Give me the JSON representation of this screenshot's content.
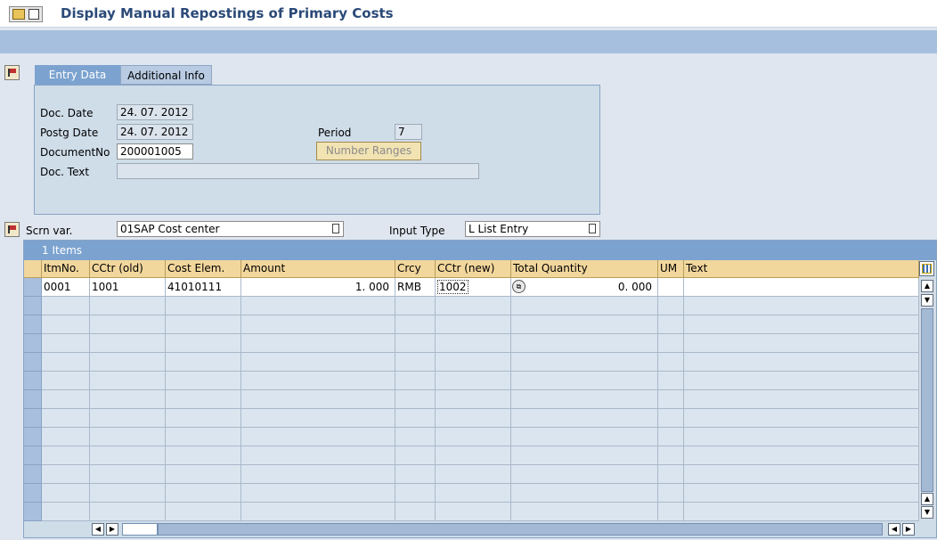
{
  "title": "Display Manual Repostings of Primary Costs",
  "tabs": [
    {
      "label": "Entry Data"
    },
    {
      "label": "Additional Info"
    }
  ],
  "entry": {
    "doc_date_label": "Doc. Date",
    "doc_date": "24. 07. 2012",
    "postg_date_label": "Postg Date",
    "postg_date": "24. 07. 2012",
    "document_no_label": "DocumentNo",
    "document_no": "200001005",
    "doc_text_label": "Doc. Text",
    "doc_text": "",
    "period_label": "Period",
    "period": "7",
    "number_ranges_label": "Number Ranges"
  },
  "screen": {
    "scrn_var_label": "Scrn var.",
    "scrn_var": "01SAP Cost center",
    "input_type_label": "Input Type",
    "input_type": "L List Entry"
  },
  "table": {
    "caption": "1 Items",
    "columns": [
      "ItmNo.",
      "CCtr (old)",
      "Cost Elem.",
      "Amount",
      "Crcy",
      "CCtr (new)",
      "Total Quantity",
      "UM",
      "Text"
    ],
    "rows": [
      {
        "itmno": "0001",
        "cctr_old": "1001",
        "cost_elem": "41010111",
        "amount": "1. 000",
        "crcy": "RMB",
        "cctr_new": "1002",
        "total_qty": "0. 000",
        "um": "",
        "text": ""
      }
    ]
  },
  "icons": {
    "title": "display-change-icon",
    "side": "hide-header-icon",
    "config": "column-config-icon"
  }
}
